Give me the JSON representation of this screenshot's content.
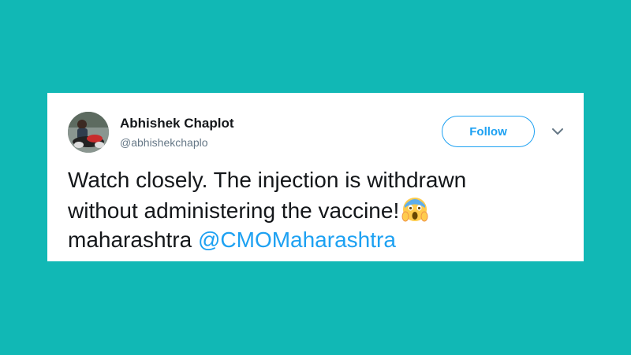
{
  "tweet": {
    "display_name": "Abhishek Chaplot",
    "handle": "@abhishekchaplo",
    "follow_label": "Follow",
    "text_line_1": "Watch closely. The injection is withdrawn",
    "text_line_2": "without administering the vaccine!",
    "emoji": "screaming-face-icon",
    "text_line_3_prefix": "maharashtra",
    "mention": "@CMOMaharashtra"
  },
  "colors": {
    "background": "#11b8b5",
    "card": "#ffffff",
    "accent": "#1da1f2",
    "text": "#14171a",
    "secondary_text": "#657786"
  }
}
